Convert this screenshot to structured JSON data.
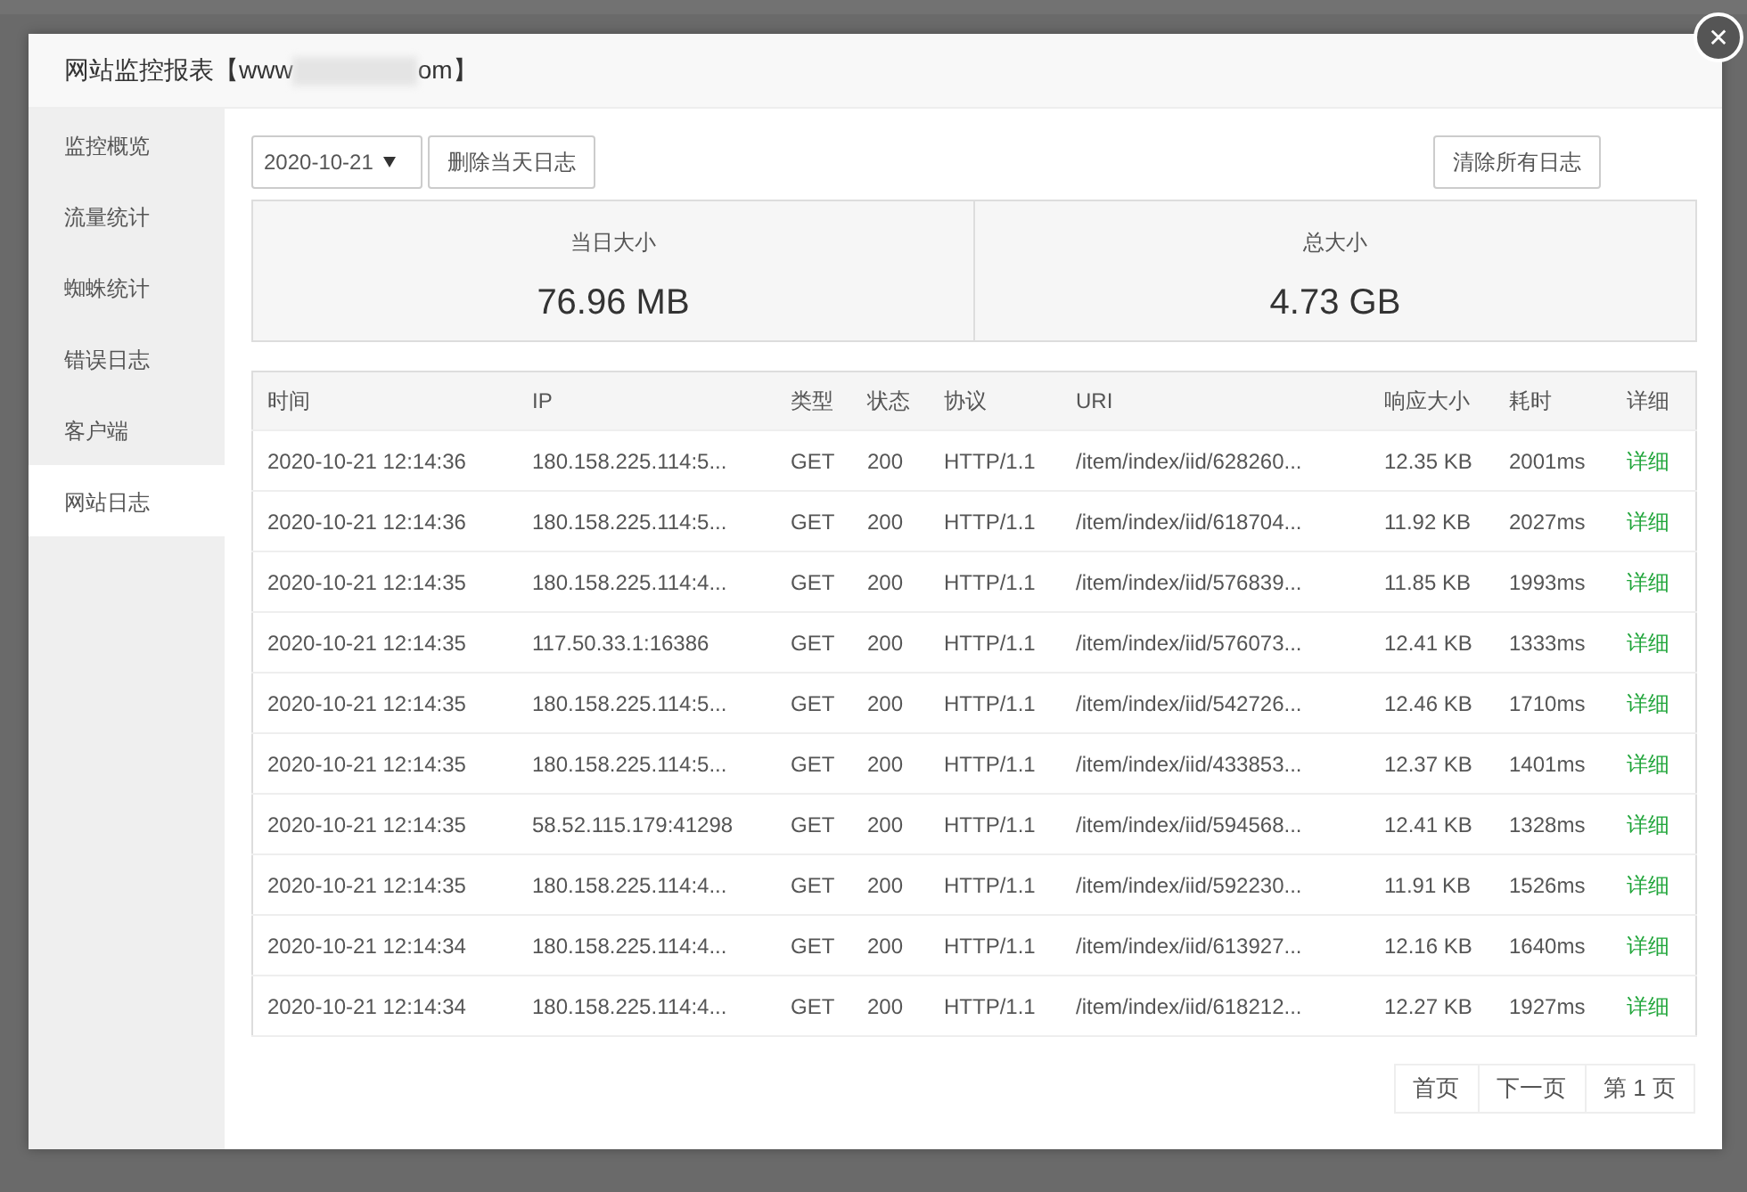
{
  "dialog": {
    "title_prefix": "网站监控报表【www",
    "title_suffix": "om】",
    "close": "✕"
  },
  "sidebar": {
    "items": [
      {
        "label": "监控概览",
        "selected": false
      },
      {
        "label": "流量统计",
        "selected": false
      },
      {
        "label": "蜘蛛统计",
        "selected": false
      },
      {
        "label": "错误日志",
        "selected": false
      },
      {
        "label": "客户端",
        "selected": false
      },
      {
        "label": "网站日志",
        "selected": true
      }
    ]
  },
  "toolbar": {
    "date": "2020-10-21",
    "delete_day": "删除当天日志",
    "clear_all": "清除所有日志"
  },
  "stats": [
    {
      "label": "当日大小",
      "value": "76.96 MB"
    },
    {
      "label": "总大小",
      "value": "4.73 GB"
    }
  ],
  "table": {
    "columns": [
      "时间",
      "IP",
      "类型",
      "状态",
      "协议",
      "URI",
      "响应大小",
      "耗时",
      "详细"
    ],
    "rows": [
      [
        "2020-10-21 12:14:36",
        "180.158.225.114:5...",
        "GET",
        "200",
        "HTTP/1.1",
        "/item/index/iid/628260...",
        "12.35 KB",
        "2001ms",
        "详细"
      ],
      [
        "2020-10-21 12:14:36",
        "180.158.225.114:5...",
        "GET",
        "200",
        "HTTP/1.1",
        "/item/index/iid/618704...",
        "11.92 KB",
        "2027ms",
        "详细"
      ],
      [
        "2020-10-21 12:14:35",
        "180.158.225.114:4...",
        "GET",
        "200",
        "HTTP/1.1",
        "/item/index/iid/576839...",
        "11.85 KB",
        "1993ms",
        "详细"
      ],
      [
        "2020-10-21 12:14:35",
        "117.50.33.1:16386",
        "GET",
        "200",
        "HTTP/1.1",
        "/item/index/iid/576073...",
        "12.41 KB",
        "1333ms",
        "详细"
      ],
      [
        "2020-10-21 12:14:35",
        "180.158.225.114:5...",
        "GET",
        "200",
        "HTTP/1.1",
        "/item/index/iid/542726...",
        "12.46 KB",
        "1710ms",
        "详细"
      ],
      [
        "2020-10-21 12:14:35",
        "180.158.225.114:5...",
        "GET",
        "200",
        "HTTP/1.1",
        "/item/index/iid/433853...",
        "12.37 KB",
        "1401ms",
        "详细"
      ],
      [
        "2020-10-21 12:14:35",
        "58.52.115.179:41298",
        "GET",
        "200",
        "HTTP/1.1",
        "/item/index/iid/594568...",
        "12.41 KB",
        "1328ms",
        "详细"
      ],
      [
        "2020-10-21 12:14:35",
        "180.158.225.114:4...",
        "GET",
        "200",
        "HTTP/1.1",
        "/item/index/iid/592230...",
        "11.91 KB",
        "1526ms",
        "详细"
      ],
      [
        "2020-10-21 12:14:34",
        "180.158.225.114:4...",
        "GET",
        "200",
        "HTTP/1.1",
        "/item/index/iid/613927...",
        "12.16 KB",
        "1640ms",
        "详细"
      ],
      [
        "2020-10-21 12:14:34",
        "180.158.225.114:4...",
        "GET",
        "200",
        "HTTP/1.1",
        "/item/index/iid/618212...",
        "12.27 KB",
        "1927ms",
        "详细"
      ]
    ]
  },
  "pagination": [
    "首页",
    "下一页",
    "第 1 页"
  ]
}
